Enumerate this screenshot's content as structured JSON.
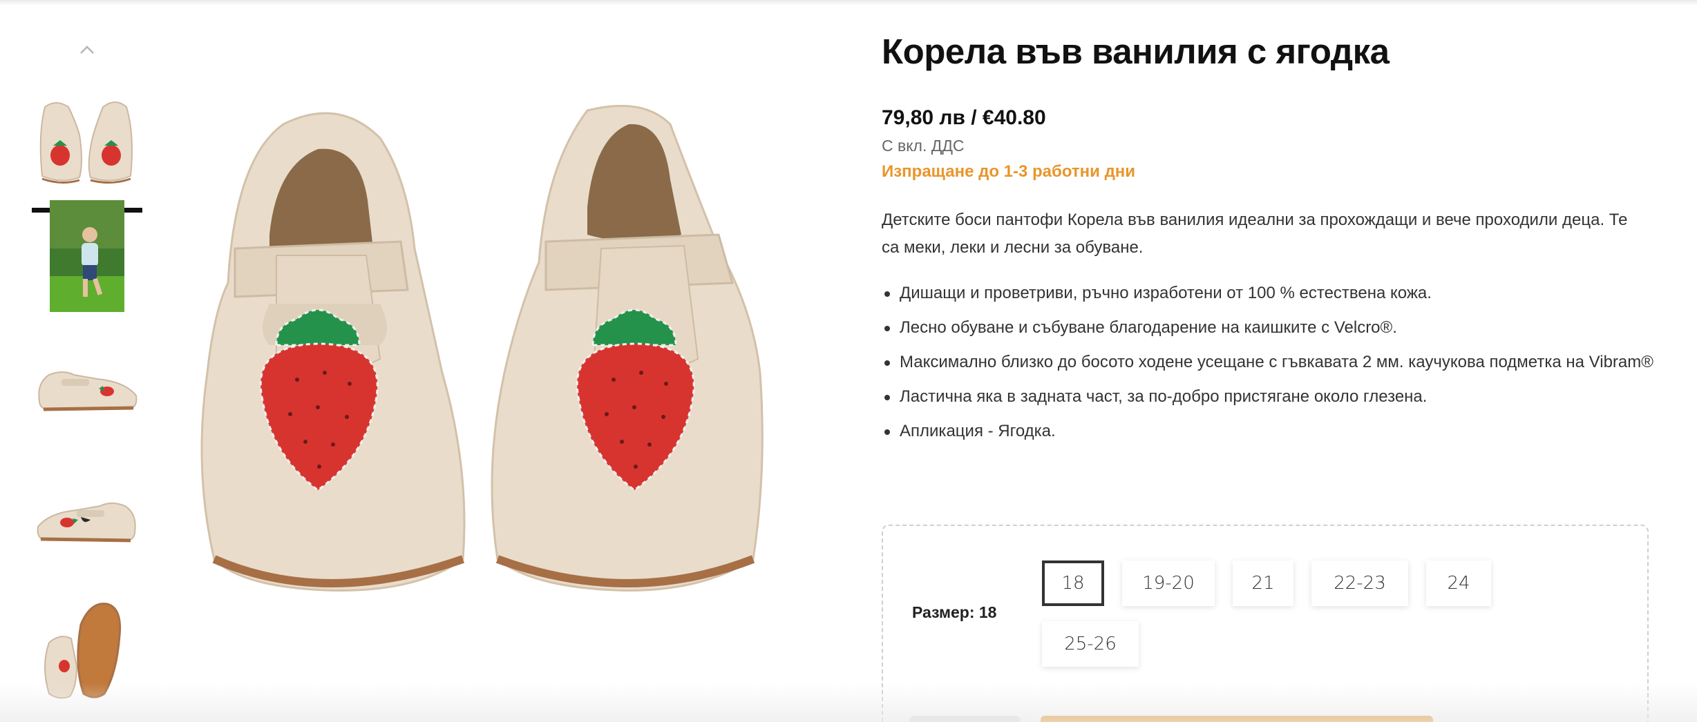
{
  "product": {
    "title": "Корела във ванилия с ягодка",
    "price": "79,80 лв / €40.80",
    "vat_note": "С вкл. ДДС",
    "shipping": "Изпращане до 1-3 работни дни",
    "description": "Детските боси пантофи Корела във ванилия идеални за прохождащи и вече проходили деца. Те са меки, леки и лесни за обуване.",
    "features": [
      "Дишащи и проветриви, ръчно изработени от 100 % естествена кожа.",
      "Лесно обуване и събуване благодарение на каишките с Velcro®.",
      "Максимално близко до босото ходене усещане с гъвкавата 2 мм. каучукова подметка на Vibram®",
      "Ластична яка в задната част, за по-добро пристягане около глезена.",
      "Апликация - Ягодка."
    ]
  },
  "size_selector": {
    "label": "Размер: 18",
    "options": [
      "18",
      "19-20",
      "21",
      "22-23",
      "24",
      "25-26"
    ],
    "selected": "18"
  },
  "gallery": {
    "thumbnails": [
      "pair-front",
      "child-walking",
      "side-left",
      "side-right",
      "sole-view"
    ],
    "active_index": 0
  },
  "colors": {
    "accent_orange": "#e8962a",
    "text_dark": "#111111",
    "leather_cream": "#e9dccb",
    "strawberry_red": "#d8342f",
    "leaf_green": "#24924a"
  }
}
